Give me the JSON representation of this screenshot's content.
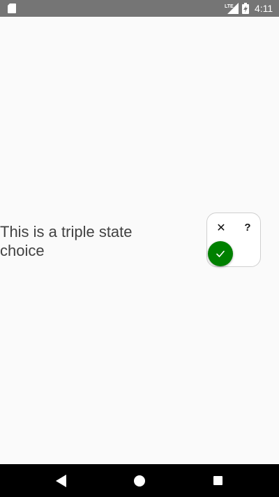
{
  "status_bar": {
    "time": "4:11",
    "network": "LTE",
    "icons": [
      "sd-card-icon",
      "lte-signal-icon",
      "battery-charging-icon"
    ],
    "background_color": "#757575"
  },
  "main": {
    "label": "This is a triple state choice",
    "triple_switch": {
      "options": [
        {
          "name": "off",
          "glyph": "✕"
        },
        {
          "name": "unknown",
          "glyph": "?"
        },
        {
          "name": "on",
          "glyph": "✓"
        }
      ],
      "selected": "on",
      "thumb_color": "#008000"
    }
  },
  "nav_bar": {
    "icons": [
      "back-icon",
      "home-icon",
      "recents-icon"
    ]
  }
}
